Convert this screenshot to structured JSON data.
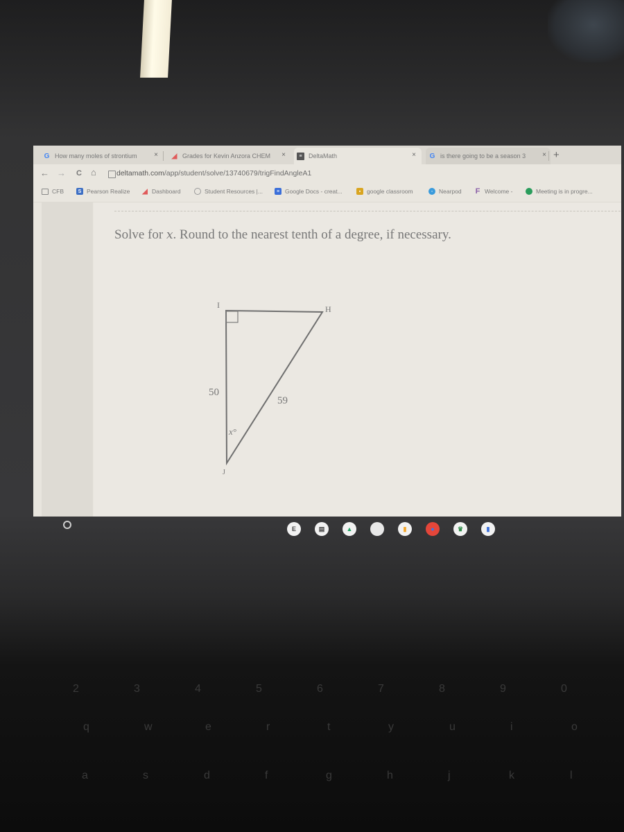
{
  "browser": {
    "tabs": [
      {
        "title": "How many moles of strontium",
        "icon": "google-icon",
        "close": "×"
      },
      {
        "title": "Grades for Kevin Anzora  CHEM",
        "icon": "schoology-icon",
        "close": "×"
      },
      {
        "title": "DeltaMath",
        "icon": "deltamath-icon",
        "close": "×",
        "active": true
      },
      {
        "title": "is there going to be a season 3",
        "icon": "google-icon",
        "close": "×"
      }
    ],
    "new_tab": "+",
    "nav": {
      "back": "←",
      "forward": "→",
      "reload": "C",
      "home": "⌂"
    },
    "url": {
      "host": "deltamath.com",
      "path": "/app/student/solve/13740679/trigFindAngleA1"
    },
    "bookmarks": [
      {
        "label": "CFB",
        "icon": "folder-icon"
      },
      {
        "label": "Pearson Realize",
        "icon": "pearson-icon"
      },
      {
        "label": "Dashboard",
        "icon": "schoology-icon"
      },
      {
        "label": "Student Resources |...",
        "icon": "globe-icon"
      },
      {
        "label": "Google Docs - creat...",
        "icon": "google-docs-icon"
      },
      {
        "label": "google classroom",
        "icon": "classroom-icon"
      },
      {
        "label": "Nearpod",
        "icon": "nearpod-icon"
      },
      {
        "label": "Welcome -",
        "icon": "welcome-icon"
      },
      {
        "label": "Meeting is in progre...",
        "icon": "meet-icon"
      }
    ]
  },
  "problem": {
    "prompt_before": "Solve for ",
    "variable": "x",
    "prompt_after": ". Round to the nearest tenth of a degree, if necessary.",
    "triangle": {
      "vertices": {
        "top_left": "I",
        "top_right": "H",
        "bottom": "J"
      },
      "right_angle_at": "I",
      "side_IJ": "50",
      "side_HJ": "59",
      "angle_label": "x°"
    }
  },
  "shelf": {
    "apps": [
      {
        "name": "explain-everything-icon",
        "glyph": "E",
        "bg": "#f2f2f2",
        "fg": "#444"
      },
      {
        "name": "files-icon",
        "glyph": "▤",
        "bg": "#f2f2f2",
        "fg": "#444"
      },
      {
        "name": "google-drive-icon",
        "glyph": "▲",
        "bg": "#f2f2f2",
        "fg": "#1fa463"
      },
      {
        "name": "app-icon",
        "glyph": "",
        "bg": "#e8e8e8",
        "fg": "#999"
      },
      {
        "name": "google-slides-icon",
        "glyph": "▮",
        "bg": "#f2f2f2",
        "fg": "#f4a62a"
      },
      {
        "name": "chrome-icon",
        "glyph": "●",
        "bg": "#e4463a",
        "fg": "#3b78e7"
      },
      {
        "name": "classroom-app-icon",
        "glyph": "♛",
        "bg": "#f2f2f2",
        "fg": "#2e8b47"
      },
      {
        "name": "google-docs-app-icon",
        "glyph": "▮",
        "bg": "#f2f2f2",
        "fg": "#3b6fd9"
      }
    ]
  },
  "keyboard": {
    "rows": [
      [
        "2",
        "3",
        "4",
        "5",
        "6",
        "7",
        "8",
        "9",
        "0"
      ],
      [
        "q",
        "w",
        "e",
        "r",
        "t",
        "y",
        "u",
        "i",
        "o"
      ],
      [
        "a",
        "s",
        "d",
        "f",
        "g",
        "h",
        "j",
        "k",
        "l"
      ]
    ]
  }
}
